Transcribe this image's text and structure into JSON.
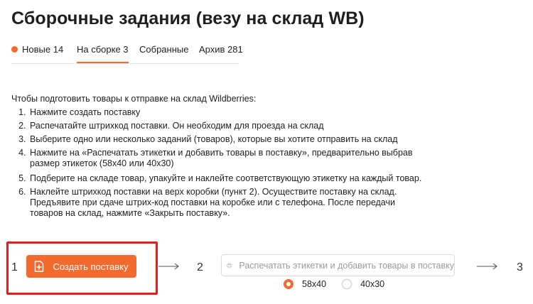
{
  "page": {
    "title": "Сборочные задания (везу на склад WB)"
  },
  "tabs": [
    {
      "label": "Новые 14",
      "has_dot": true
    },
    {
      "label": "На сборке 3",
      "active": true
    },
    {
      "label": "Собранные"
    },
    {
      "label": "Архив 281"
    }
  ],
  "instructions": {
    "intro": "Чтобы подготовить товары к отправке на склад Wildberries:",
    "steps": [
      "Нажмите создать поставку",
      "Распечатайте штрихкод поставки. Он необходим для проезда на склад",
      "Выберите одно или несколько заданий (товаров), которые вы хотите отправить на склад",
      "Нажмите на «Распечатать этикетки и добавить товары в поставку», предварительно выбрав размер этикеток (58x40 или 40x30)",
      "Подберите на складе товар, упакуйте и наклейте соответствующую этикетку на каждый товар.",
      "Наклейте штрихкод поставки на верх коробки (пункт 2). Осуществите поставку на склад. Предъявите при сдаче штрих-код поставки на коробке или с телефона. После передачи товаров на склад, нажмите «Закрыть поставку»."
    ]
  },
  "workflow": {
    "step1_number": "1",
    "step2_number": "2",
    "step3_number": "3",
    "create_button_label": "Создать поставку",
    "print_button_label": "Распечатать этикетки и добавить товары в поставку",
    "label_sizes": [
      {
        "label": "58x40",
        "checked": true
      },
      {
        "label": "40x30",
        "checked": false
      }
    ]
  },
  "colors": {
    "accent": "#f26a2e",
    "highlight": "#e02020"
  }
}
